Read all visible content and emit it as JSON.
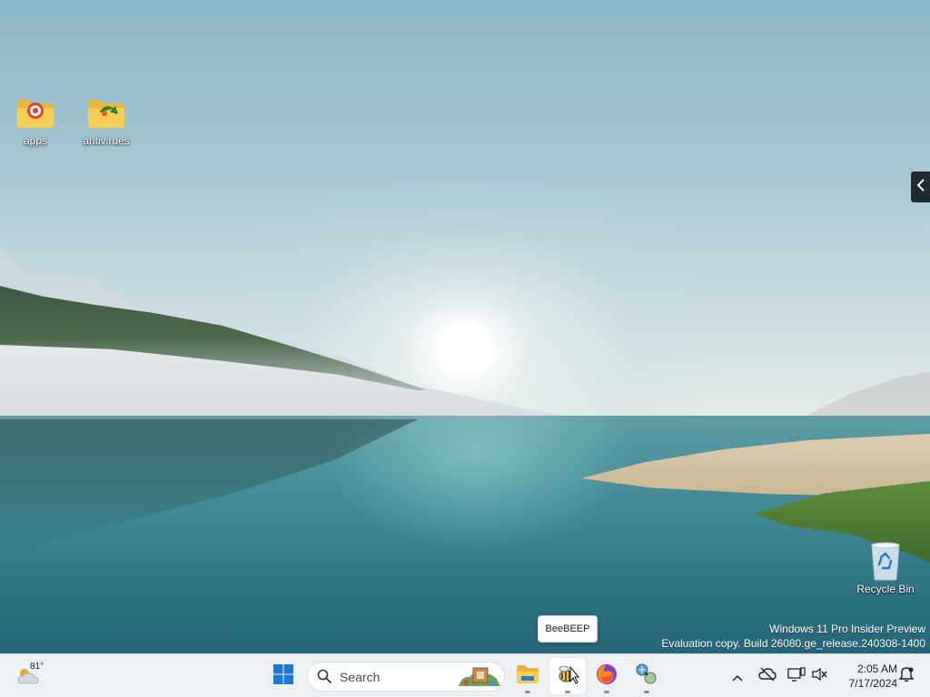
{
  "desktop": {
    "icons": [
      {
        "label": "apps"
      },
      {
        "label": "antivirues"
      }
    ],
    "recycle_bin": {
      "label": "Recycle Bin"
    }
  },
  "watermark": {
    "line1": "Windows 11 Pro Insider Preview",
    "line2": "Evaluation copy. Build 26080.ge_release.240308-1400"
  },
  "tooltip": {
    "text": "BeeBEEP"
  },
  "taskbar": {
    "weather": {
      "temp": "81°"
    },
    "search": {
      "label": "Search"
    },
    "apps": [
      "Start",
      "File Explorer",
      "BeeBEEP",
      "Firefox",
      "Network tool"
    ],
    "clock": {
      "time": "2:05 AM",
      "date": "7/17/2024"
    }
  },
  "colors": {
    "taskbar_bg": "#eef1f4",
    "folder_yellow": "#f5c84a",
    "start_blue": "#1a78d6"
  }
}
